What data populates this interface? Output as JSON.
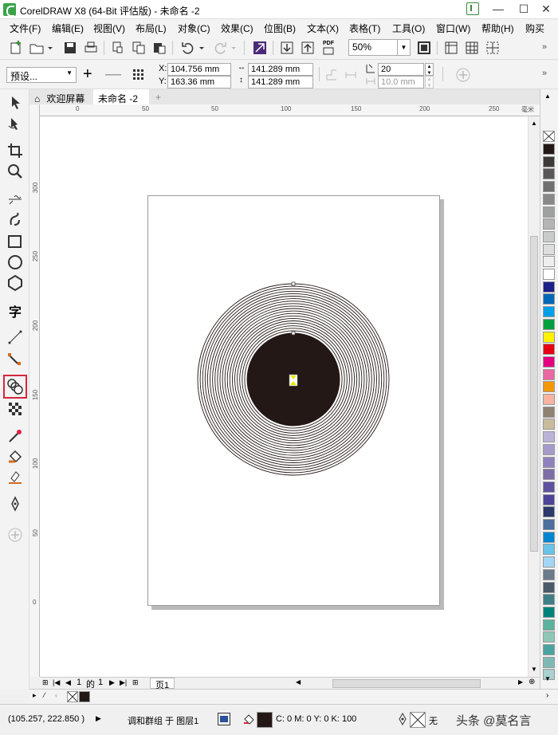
{
  "window": {
    "title": "CorelDRAW X8 (64-Bit 评估版) - 未命名 -2",
    "controls": [
      "—",
      "☐",
      "✕"
    ]
  },
  "menu": {
    "items": [
      "文件(F)",
      "编辑(E)",
      "视图(V)",
      "布局(L)",
      "对象(C)",
      "效果(C)",
      "位图(B)",
      "文本(X)",
      "表格(T)",
      "工具(O)",
      "窗口(W)",
      "帮助(H)",
      "购买"
    ]
  },
  "toolbar": {
    "zoom": "50%",
    "pdf_label": "PDF"
  },
  "property_bar": {
    "preset": "预设...",
    "x_label": "X:",
    "x_value": "104.756 mm",
    "y_label": "Y:",
    "y_value": "163.36 mm",
    "width_value": "141.289 mm",
    "height_value": "141.289 mm",
    "steps_value": "20",
    "offset_value": "10.0 mm"
  },
  "tabs": [
    {
      "label": "欢迎屏幕",
      "icon": "home-icon"
    },
    {
      "label": "未命名 -2"
    }
  ],
  "ruler": {
    "h_labels": [
      "50",
      "0",
      "50",
      "100",
      "150",
      "200",
      "250"
    ],
    "h_unit": "毫米",
    "v_labels": [
      "300",
      "250",
      "200",
      "150",
      "100",
      "50",
      "0"
    ]
  },
  "page_nav": {
    "current": "1",
    "of_label": "的",
    "total": "1",
    "page_tab": "页1"
  },
  "palette_colors": [
    "#231815",
    "#3e3a39",
    "#595757",
    "#727171",
    "#898989",
    "#9fa0a0",
    "#b5b5b6",
    "#c9caca",
    "#dcdddd",
    "#efefef",
    "#ffffff",
    "#1d2088",
    "#0068b7",
    "#00a0e9",
    "#00a040",
    "#fff100",
    "#e60012",
    "#e4007f",
    "#ea68a2",
    "#f39800",
    "#f8b4a0",
    "#8f8271",
    "#c9bc9c",
    "#bcb3d8",
    "#a59aca",
    "#8f82bc",
    "#7d6ea7",
    "#5f52a0",
    "#4d4398",
    "#2b3a6b",
    "#4c6f9c",
    "#0086d1",
    "#68c4e8",
    "#a3d6f5",
    "#6c7b8b",
    "#495a6a",
    "#3f7f87",
    "#00837b",
    "#5bb39e",
    "#8fc7b7",
    "#4ba3a1",
    "#7fb9b7",
    "#a8d1cf"
  ],
  "status": {
    "coords": "(105.257, 222.850 )",
    "object_info": "调和群组 于 图层1",
    "color_info": "C: 0 M: 0 Y: 0 K: 100",
    "outline_none": "无",
    "watermark": "头条 @莫名言"
  }
}
